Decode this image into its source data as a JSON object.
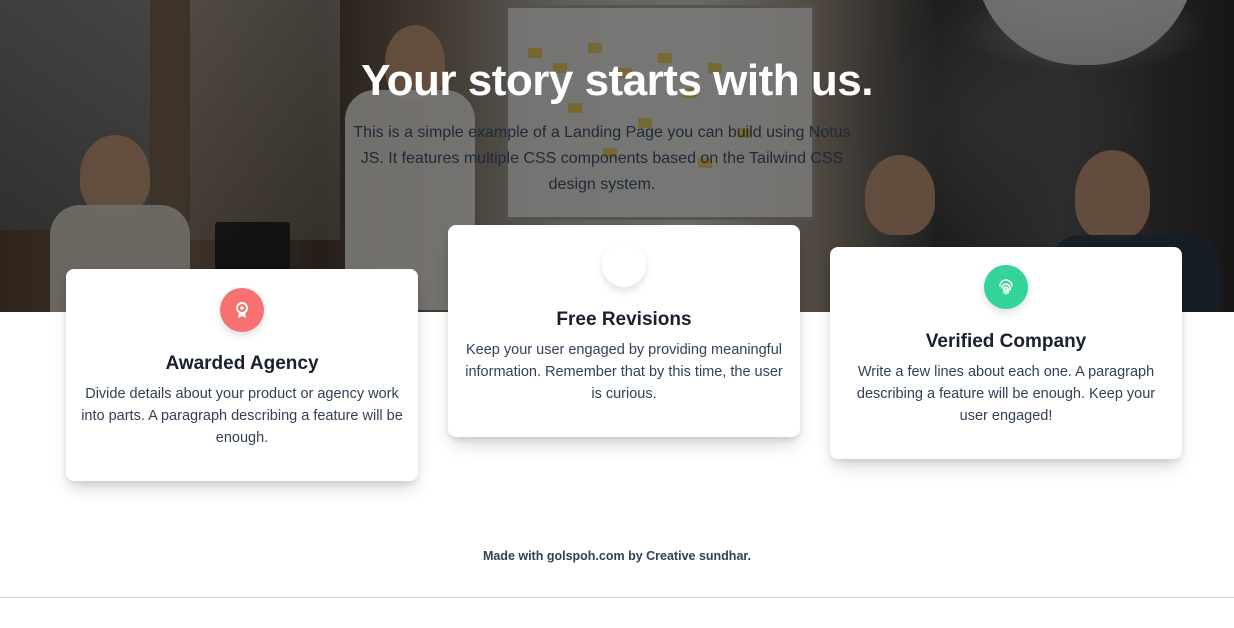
{
  "hero": {
    "title": "Your story starts with us.",
    "subtitle": "This is a simple example of a Landing Page you can build using Notus JS. It features multiple CSS components based on the Tailwind CSS design system."
  },
  "features": [
    {
      "icon": "award-icon",
      "icon_color": "#f87171",
      "title": "Awarded Agency",
      "text": "Divide details about your product or agency work into parts. A paragraph describing a feature will be enough."
    },
    {
      "icon": "revisions-icon",
      "icon_color": "#ffffff",
      "title": "Free Revisions",
      "text": "Keep your user engaged by providing meaningful information. Remember that by this time, the user is curious."
    },
    {
      "icon": "fingerprint-icon",
      "icon_color": "#34d399",
      "title": "Verified Company",
      "text": "Write a few lines about each one. A paragraph describing a feature will be enough. Keep your user engaged!"
    }
  ],
  "footer": {
    "credit": "Made with golspoh.com by Creative sundhar."
  }
}
